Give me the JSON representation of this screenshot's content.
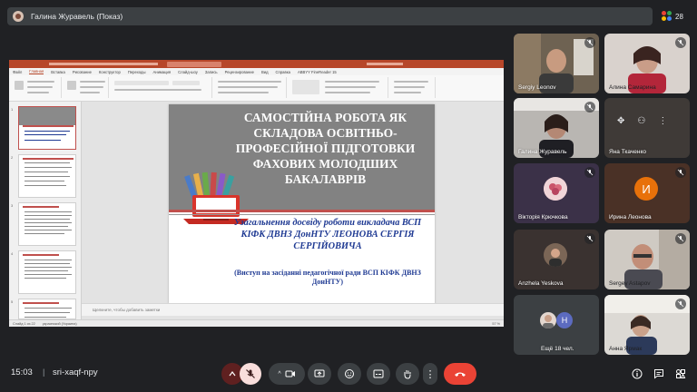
{
  "meeting": {
    "presenter_title": "Галина Журавель (Показ)",
    "participants_count": "28",
    "time": "15:03",
    "separator": "|",
    "meeting_code": "sri-xaqf-npy"
  },
  "slide": {
    "title": "САМОСТІЙНА РОБОТА ЯК СКЛАДОВА ОСВІТНЬО-ПРОФЕСІЙНОЇ ПІДГОТОВКИ ФАХОВИХ МОЛОДШИХ БАКАЛАВРІВ",
    "subtitle": "Узагальнення досвіду роботи викладача ВСП КІФК ДВНЗ ДонНТУ ЛЕОНОВА СЕРГІЯ СЕРГІЙОВИЧА",
    "note": "(Виступ на засіданні педагогічної ради ВСП КІФК ДВНЗ ДонНТУ)"
  },
  "ppt": {
    "tabs": [
      "Файл",
      "Главная",
      "Вставка",
      "Рисование",
      "Конструктор",
      "Переходы",
      "Анимация",
      "Слайд-шоу",
      "Запись",
      "Рецензирование",
      "Вид",
      "Справка",
      "ABBYY FineReader 15"
    ],
    "active_tab": "Главная",
    "notes_placeholder": "Щелкните, чтобы добавить заметки",
    "status_slide": "Слайд 1 из 22",
    "status_lang": "украинский (Украина)",
    "status_zoom": "57 %",
    "thumb_numbers": [
      "1",
      "2",
      "3",
      "4",
      "5"
    ]
  },
  "participants": [
    {
      "name": "Sergiy Leonov",
      "mic": "muted"
    },
    {
      "name": "Алина Самарина",
      "mic": "muted"
    },
    {
      "name": "Галина Журавель",
      "mic": "muted"
    },
    {
      "name": "Яна Ткаченко",
      "mic": "none"
    },
    {
      "name": "Вікторія Крючкова",
      "mic": "muted"
    },
    {
      "name": "Ирина Леонова",
      "mic": "muted",
      "initial": "И"
    },
    {
      "name": "Anzhela Yeskova",
      "mic": "muted"
    },
    {
      "name": "Sergey Astapov",
      "mic": "muted"
    },
    {
      "name": "Ещё 18 чел.",
      "mic": "none",
      "initial": "Н"
    },
    {
      "name": "Анна Ярмак",
      "mic": "muted"
    }
  ],
  "colors": {
    "background": "#202124",
    "tile": "#3c4043",
    "end_call": "#ea4335",
    "ppt_accent": "#b7472a",
    "slide_title_bg": "#828282",
    "slide_accent_red": "#c0504d",
    "slide_text_blue": "#1f3a93",
    "avatar_orange": "#e8710a"
  },
  "icons": [
    "people-icon",
    "mic-off-icon",
    "camera-icon",
    "present-icon",
    "emoji-icon",
    "captions-icon",
    "raise-hand-icon",
    "more-vert-icon",
    "end-call-icon",
    "info-icon",
    "chat-icon",
    "activities-icon"
  ]
}
